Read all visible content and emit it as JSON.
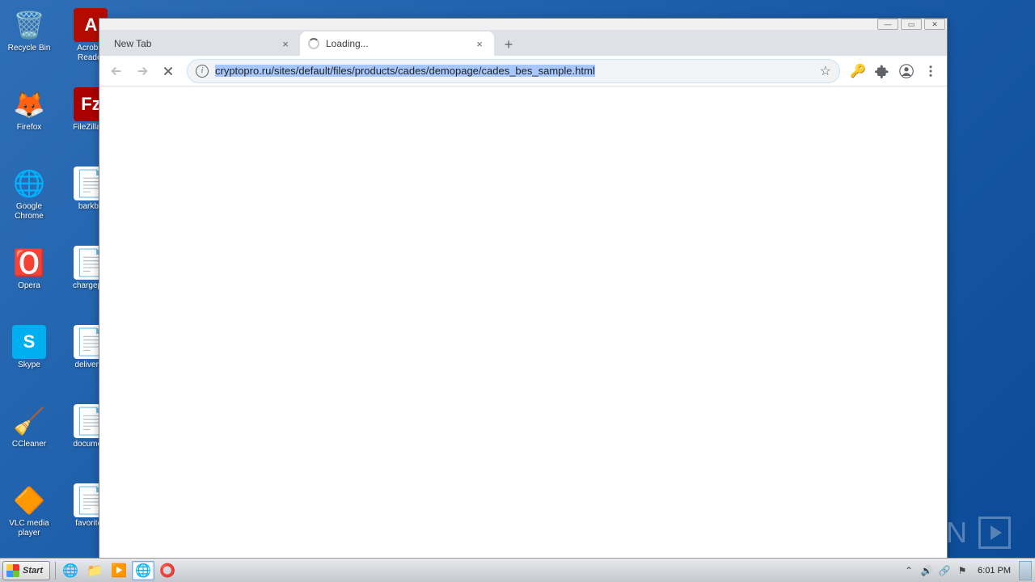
{
  "desktop": {
    "col1": [
      {
        "label": "Recycle Bin",
        "icon": "recycle-bin",
        "bg": "transparent",
        "glyph": "🗑️"
      },
      {
        "label": "Firefox",
        "icon": "firefox",
        "bg": "transparent",
        "glyph": "🦊"
      },
      {
        "label": "Google Chrome",
        "icon": "chrome",
        "bg": "transparent",
        "glyph": "🌐"
      },
      {
        "label": "Opera",
        "icon": "opera",
        "bg": "transparent",
        "glyph": "🅾️"
      },
      {
        "label": "Skype",
        "icon": "skype",
        "bg": "#00aff0",
        "glyph": "S"
      },
      {
        "label": "CCleaner",
        "icon": "ccleaner",
        "bg": "transparent",
        "glyph": "🧹"
      },
      {
        "label": "VLC media player",
        "icon": "vlc",
        "bg": "transparent",
        "glyph": "🔶"
      }
    ],
    "col2": [
      {
        "label": "Acrobat Reader",
        "icon": "acrobat",
        "bg": "#b30b00",
        "glyph": "A"
      },
      {
        "label": "FileZilla C",
        "icon": "filezilla",
        "bg": "#a00",
        "glyph": "Fz"
      },
      {
        "label": "barkb.r",
        "icon": "word-doc",
        "bg": "#fff",
        "glyph": "📄"
      },
      {
        "label": "chargepro",
        "icon": "word-doc",
        "bg": "#fff",
        "glyph": "📄"
      },
      {
        "label": "deliveryh",
        "icon": "word-doc",
        "bg": "#fff",
        "glyph": "📄"
      },
      {
        "label": "document",
        "icon": "word-doc",
        "bg": "#fff",
        "glyph": "📄"
      },
      {
        "label": "favorited",
        "icon": "word-doc",
        "bg": "#fff",
        "glyph": "📄"
      }
    ]
  },
  "browser": {
    "tabs": [
      {
        "title": "New Tab",
        "loading": false,
        "active": false
      },
      {
        "title": "Loading...",
        "loading": true,
        "active": true
      }
    ],
    "url": "cryptopro.ru/sites/default/files/products/cades/demopage/cades_bes_sample.html",
    "win_controls": {
      "min": "—",
      "max": "▭",
      "close": "✕"
    }
  },
  "taskbar": {
    "start": "Start",
    "clock": "6:01 PM"
  },
  "watermark": "ANY        RUN"
}
